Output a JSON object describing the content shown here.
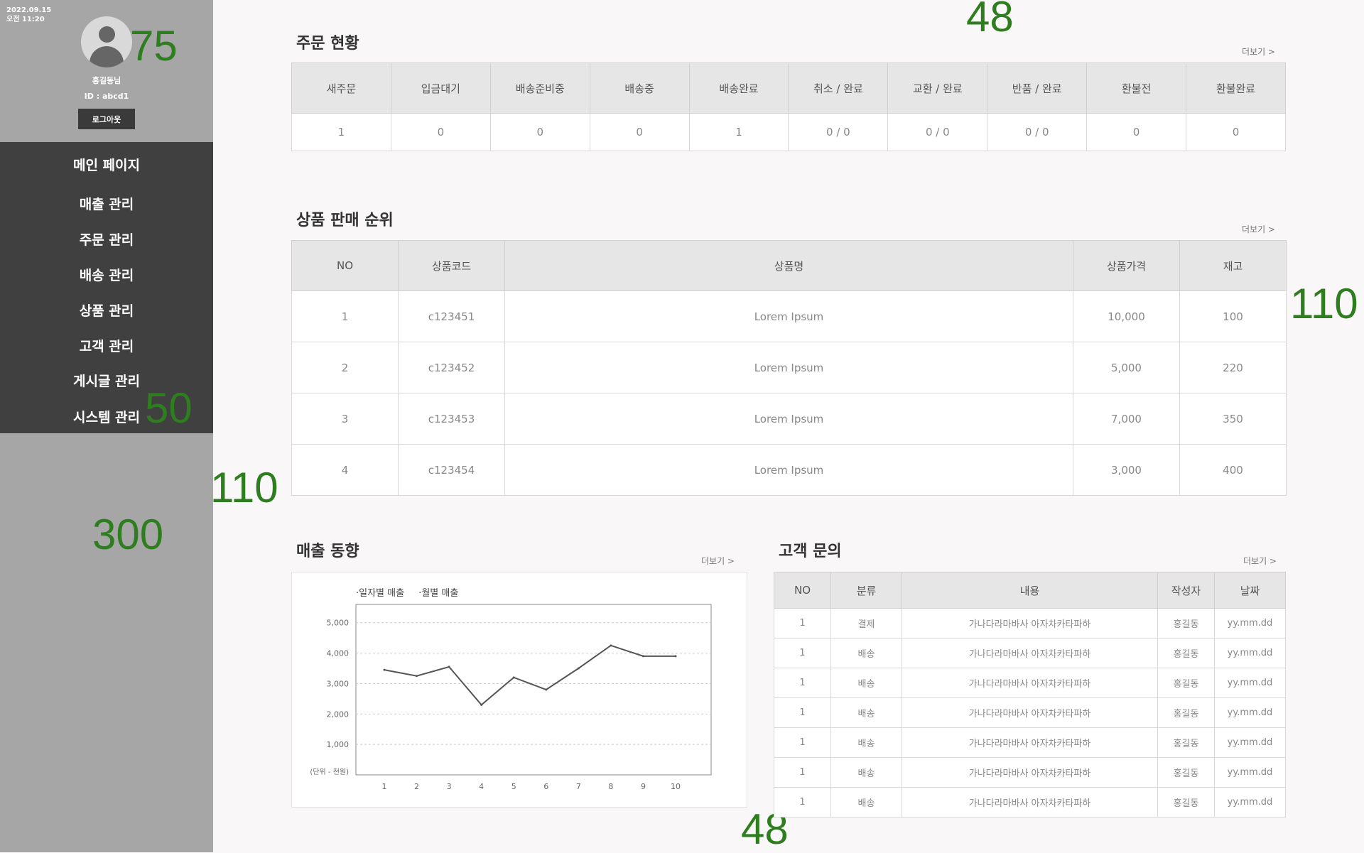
{
  "sidebar": {
    "date": "2022.09.15",
    "time": "오전 11:20",
    "user_name": "홍길동님",
    "user_id": "ID : abcd1",
    "logout": "로그아웃",
    "menu": [
      "메인 페이지",
      "매출 관리",
      "주문 관리",
      "배송 관리",
      "상품 관리",
      "고객 관리",
      "게시글 관리",
      "시스템 관리"
    ]
  },
  "annotations": [
    "75",
    "48",
    "110",
    "50",
    "110",
    "300",
    "48"
  ],
  "orders": {
    "title": "주문 현황",
    "more": "더보기 >",
    "headers": [
      "새주문",
      "입금대기",
      "배송준비중",
      "배송중",
      "배송완료",
      "취소 / 완료",
      "교환 / 완료",
      "반품 / 완료",
      "환불전",
      "환불완료"
    ],
    "values": [
      "1",
      "0",
      "0",
      "0",
      "1",
      "0 / 0",
      "0 / 0",
      "0 / 0",
      "0",
      "0"
    ]
  },
  "products": {
    "title": "상품 판매 순위",
    "more": "더보기 >",
    "headers": [
      "NO",
      "상품코드",
      "상품명",
      "상품가격",
      "재고"
    ],
    "rows": [
      [
        "1",
        "c123451",
        "Lorem Ipsum",
        "10,000",
        "100"
      ],
      [
        "2",
        "c123452",
        "Lorem Ipsum",
        "5,000",
        "220"
      ],
      [
        "3",
        "c123453",
        "Lorem Ipsum",
        "7,000",
        "350"
      ],
      [
        "4",
        "c123454",
        "Lorem Ipsum",
        "3,000",
        "400"
      ]
    ]
  },
  "sales": {
    "title": "매출 동향",
    "more": "더보기 >",
    "legend": [
      "·일자별 매출",
      "·월별 매출"
    ],
    "unit": "(단위 - 천원)"
  },
  "chart_data": {
    "type": "line",
    "x": [
      1,
      2,
      3,
      4,
      5,
      6,
      7,
      8,
      9,
      10
    ],
    "series": [
      {
        "values": [
          3450,
          3250,
          3550,
          2300,
          3200,
          2800,
          3500,
          4250,
          3900,
          3900
        ]
      }
    ],
    "yticks": [
      1000,
      2000,
      3000,
      4000,
      5000
    ],
    "ytick_labels": [
      "1,000",
      "2,000",
      "3,000",
      "4,000",
      "5,000"
    ],
    "ylim": [
      0,
      5600
    ],
    "grid": true
  },
  "inquiries": {
    "title": "고객 문의",
    "more": "더보기 >",
    "headers": [
      "NO",
      "분류",
      "내용",
      "작성자",
      "날짜"
    ],
    "rows": [
      [
        "1",
        "결제",
        "가나다라마바사 아자차카타파하",
        "홍길동",
        "yy.mm.dd"
      ],
      [
        "1",
        "배송",
        "가나다라마바사 아자차카타파하",
        "홍길동",
        "yy.mm.dd"
      ],
      [
        "1",
        "배송",
        "가나다라마바사 아자차카타파하",
        "홍길동",
        "yy.mm.dd"
      ],
      [
        "1",
        "배송",
        "가나다라마바사 아자차카타파하",
        "홍길동",
        "yy.mm.dd"
      ],
      [
        "1",
        "배송",
        "가나다라마바사 아자차카타파하",
        "홍길동",
        "yy.mm.dd"
      ],
      [
        "1",
        "배송",
        "가나다라마바사 아자차카타파하",
        "홍길동",
        "yy.mm.dd"
      ],
      [
        "1",
        "배송",
        "가나다라마바사 아자차카타파하",
        "홍길동",
        "yy.mm.dd"
      ]
    ]
  }
}
